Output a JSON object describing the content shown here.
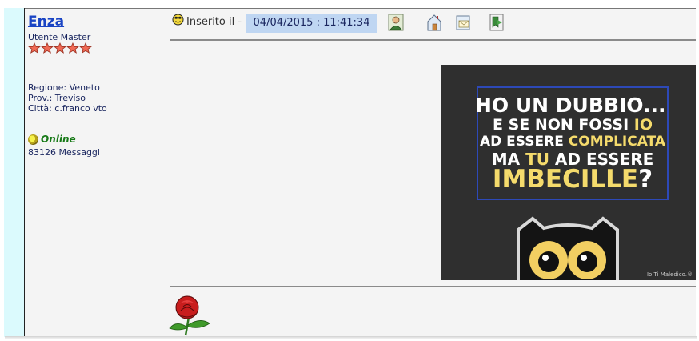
{
  "author": {
    "name": "Enza",
    "rank": "Utente Master",
    "stars": 5,
    "region": "Regione: Veneto",
    "province": "Prov.: Treviso",
    "city": "Città: c.franco vto",
    "status": "Online",
    "messages": "83126 Messaggi"
  },
  "post": {
    "posted_label": "Inserito il -",
    "posted_date": "04/04/2015 : 11:41:34",
    "actions": [
      "profile-icon",
      "homepage-icon",
      "email-icon",
      "bookmark-icon"
    ],
    "meme": {
      "line1": "HO UN DUBBIO...",
      "line2_a": "E SE NON FOSSI ",
      "line2_b": "IO",
      "line3_a": "AD ESSERE ",
      "line3_b": "COMPLICATA",
      "line4_a": "MA ",
      "line4_b": "TU",
      "line4_c": " AD ESSERE",
      "line5_a": "IMBECILLE",
      "line5_b": "?",
      "credit": "Io Ti Maledico.®"
    },
    "signature_icon": "rose-icon"
  },
  "colors": {
    "name_link": "#1a44c4",
    "date_highlight": "#bfd6f2",
    "online_text": "#187a18",
    "meme_highlight": "#f5db6c",
    "meme_border": "#2d49b8"
  }
}
